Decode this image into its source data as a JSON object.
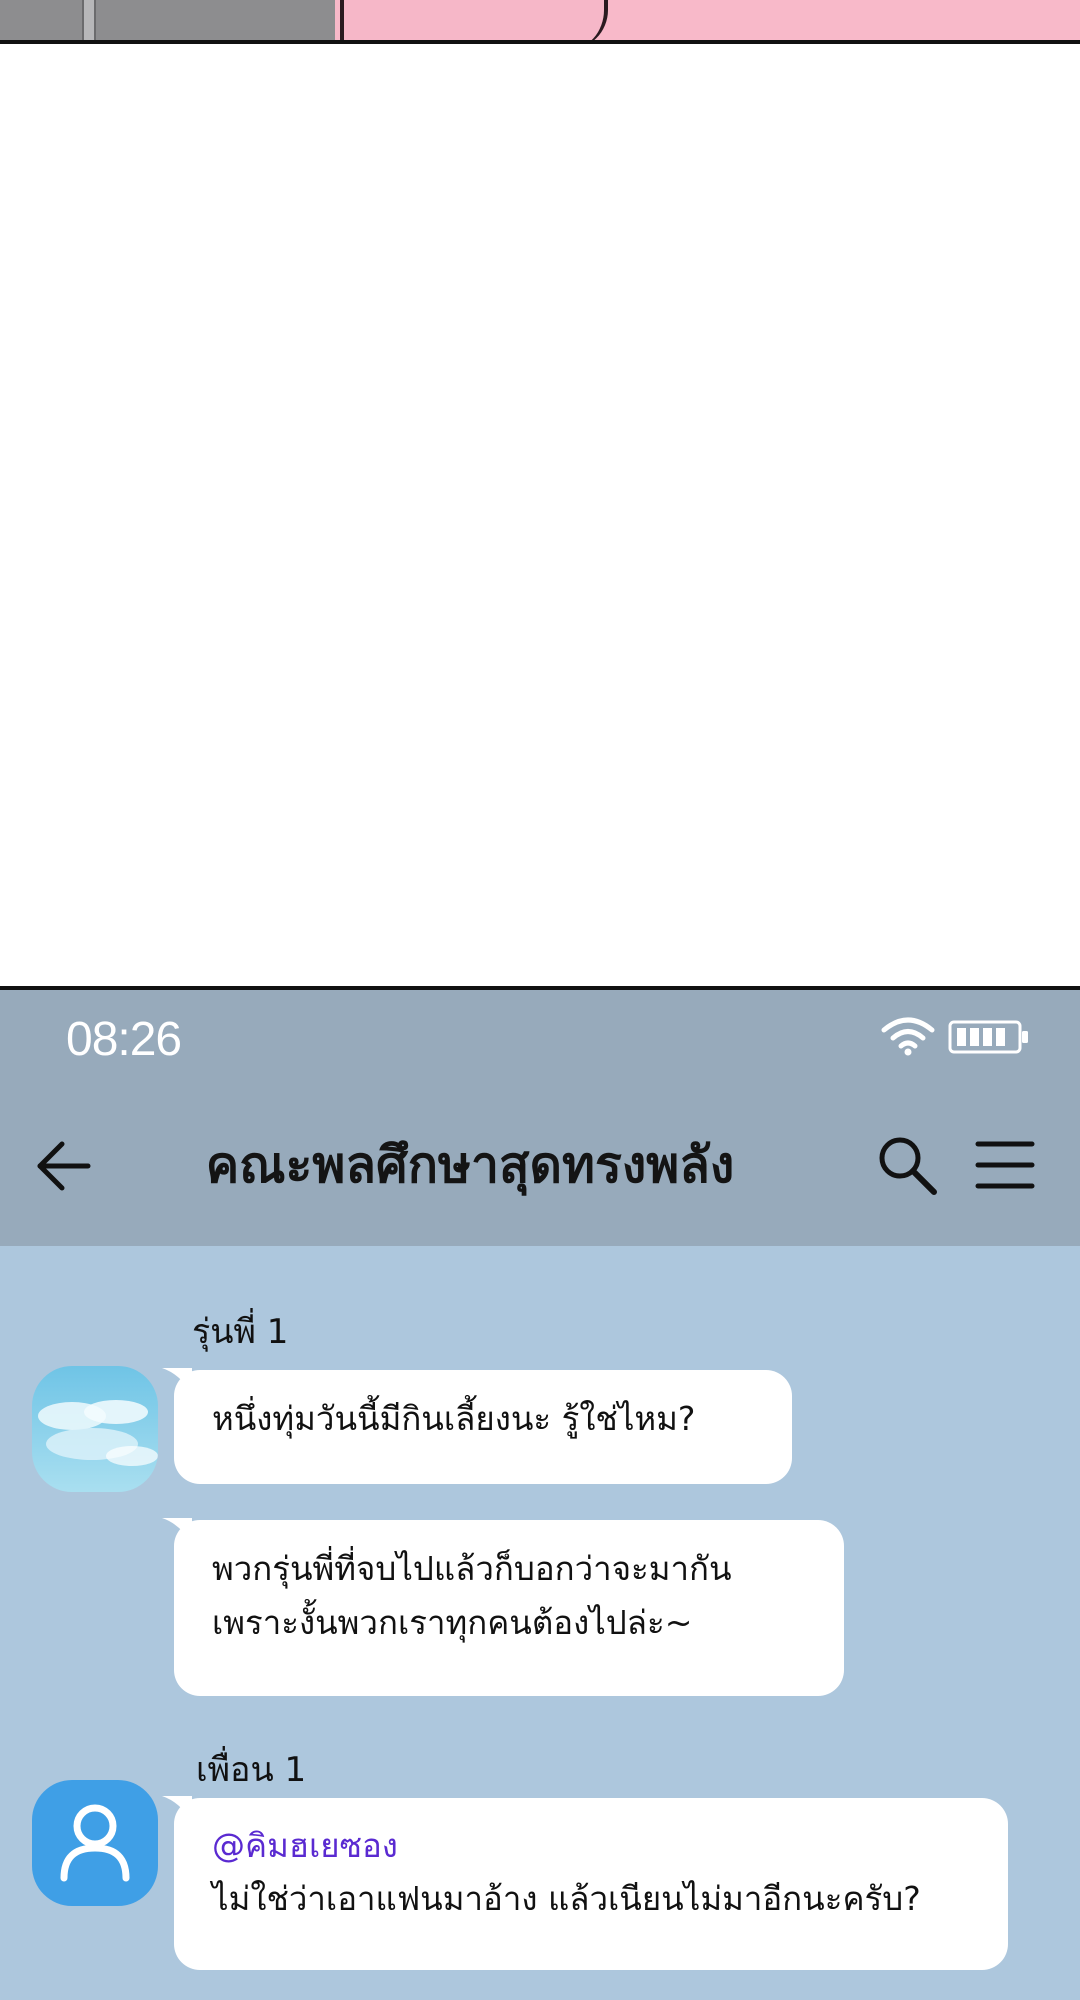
{
  "status_bar": {
    "time": "08:26"
  },
  "header": {
    "title": "คณะพลศึกษาสุดทรงพลัง"
  },
  "messages": [
    {
      "sender": "รุ่นพี่ 1",
      "lines": [
        "หนึ่งทุ่มวันนี้มีกินเลี้ยงนะ รู้ใช่ไหม?"
      ]
    },
    {
      "sender": "",
      "lines": [
        "พวกรุ่นพี่ที่จบไปแล้วก็บอกว่าจะมากัน",
        "เพราะงั้นพวกเราทุกคนต้องไปล่ะ~"
      ]
    },
    {
      "sender": "เพื่อน 1",
      "mention": "@คิมฮเยซอง",
      "lines": [
        "ไม่ใช่ว่าเอาแฟนมาอ้าง แล้วเนียนไม่มาอีกนะครับ?"
      ]
    }
  ],
  "colors": {
    "chat_background": "#adc7dd",
    "header_background": "#97aabb",
    "bubble": "#ffffff",
    "mention": "#5a2ad1",
    "avatar_default": "#3f9fe6"
  },
  "icons": {
    "back": "arrow-left-icon",
    "search": "search-icon",
    "menu": "hamburger-menu-icon",
    "wifi": "wifi-icon",
    "battery": "battery-icon",
    "avatar_default": "person-icon"
  }
}
